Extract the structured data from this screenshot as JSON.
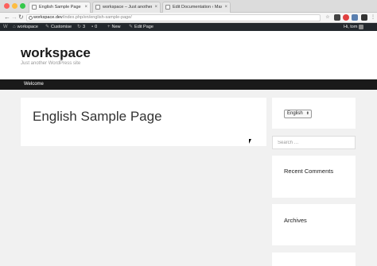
{
  "browser": {
    "tabs": [
      {
        "title": "English Sample Page – worksp",
        "active": true
      },
      {
        "title": "workspace – Just another Wo",
        "active": false
      },
      {
        "title": "Edit Documentation ‹ Max Mo",
        "active": false
      }
    ],
    "url_host": "workspace.dev",
    "url_path": "/index.php/en/english-sample-page/"
  },
  "adminbar": {
    "wp_logo": "W",
    "site_name": "workspace",
    "customise": "Customise",
    "updates_count": "3",
    "comments_count": "0",
    "new_label": "New",
    "edit_page": "Edit Page",
    "greeting": "Hi, tom"
  },
  "site": {
    "title": "workspace",
    "description": "Just another WordPress site"
  },
  "nav": {
    "items": [
      "Welcome"
    ]
  },
  "content": {
    "page_title": "English Sample Page"
  },
  "sidebar": {
    "language_selected": "English",
    "search_placeholder": "Search …",
    "recent_comments_title": "Recent Comments",
    "archives_title": "Archives"
  },
  "colors": {
    "adminbar": "#23282d",
    "nav": "#1a1a1a",
    "background": "#f1f1f1"
  }
}
